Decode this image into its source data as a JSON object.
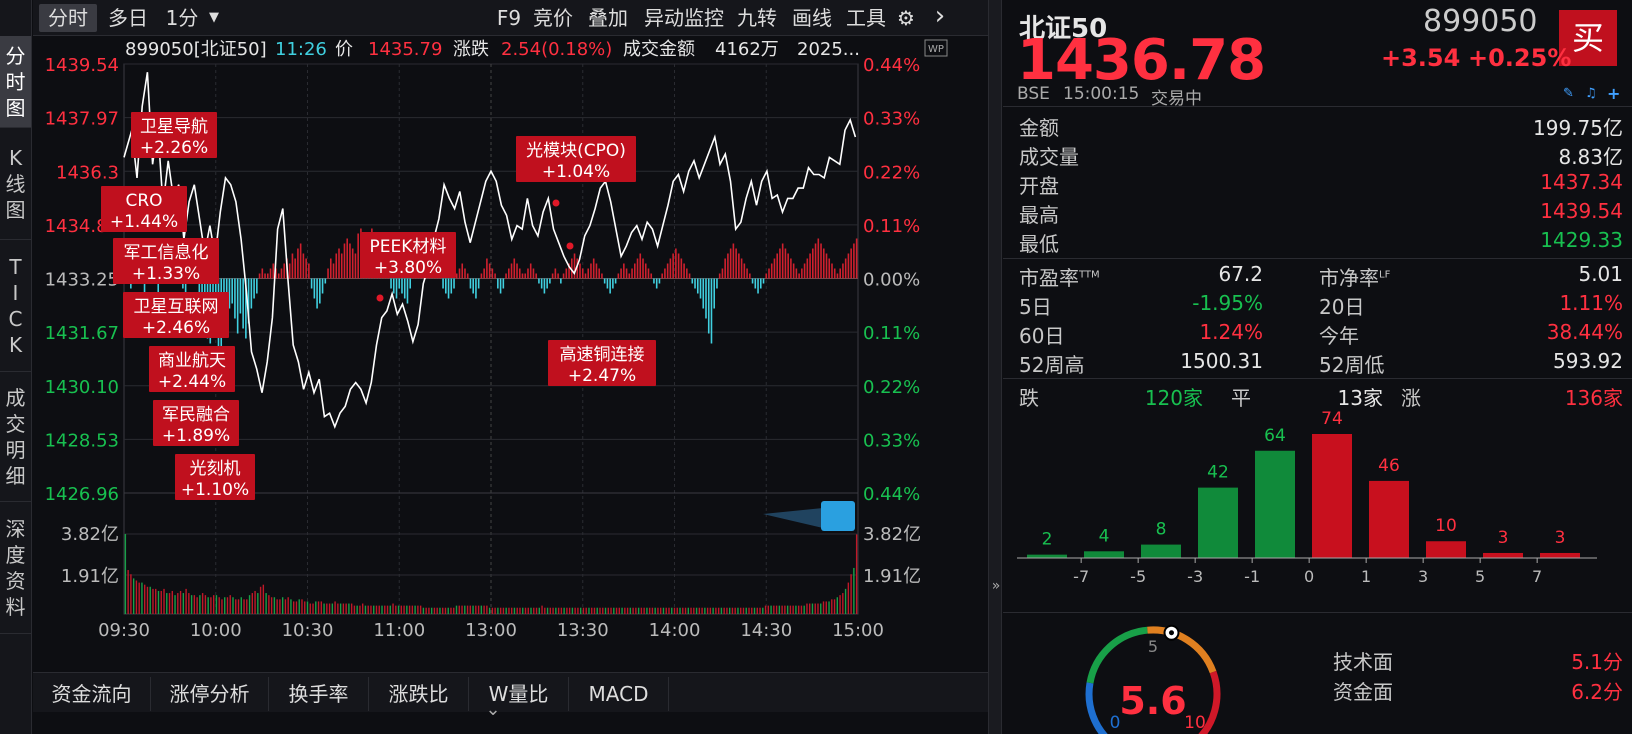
{
  "toolbar": {
    "tabs": [
      "分时",
      "多日",
      "1分"
    ],
    "dropdown_arrow": "▼",
    "items": [
      "F9",
      "竞价",
      "叠加",
      "异动监控",
      "九转",
      "画线",
      "工具"
    ],
    "gear": "⚙",
    "next": "›"
  },
  "sidebar": {
    "items": [
      [
        "分",
        "时",
        "图"
      ],
      [
        "K",
        "线",
        "图"
      ],
      [
        "T",
        "I",
        "C",
        "K"
      ],
      [
        "成",
        "交",
        "明",
        "细"
      ],
      [
        "深",
        "度",
        "资",
        "料"
      ]
    ]
  },
  "info_line": {
    "code": "899050[北证50]",
    "time": "11:26",
    "price_label": "价",
    "price": "1435.79",
    "change_label": "涨跌",
    "change": "2.54(0.18%)",
    "amount_label": "成交金额",
    "amount": "4162万",
    "date": "2025..."
  },
  "wp_icon": "WP",
  "chart_data": {
    "type": "line",
    "prev_close": 1433.25,
    "price_ticks": [
      "1439.54",
      "1437.97",
      "1436.39",
      "1434.82",
      "1433.25",
      "1431.67",
      "1430.10",
      "1428.53",
      "1426.96"
    ],
    "price_ticks_visible": [
      "1439.54",
      "1437.97",
      "1436.3",
      "1434.82",
      "1433.25",
      "1431.67",
      "1430.10",
      "1428.53",
      "1426.96"
    ],
    "pct_ticks": [
      "0.44%",
      "0.33%",
      "0.22%",
      "0.11%",
      "0.00%",
      "0.11%",
      "0.22%",
      "0.33%",
      "0.44%"
    ],
    "pct_colors": [
      "#ff3040",
      "#ff3040",
      "#ff3040",
      "#ff3040",
      "#bbbbbb",
      "#18c050",
      "#18c050",
      "#18c050",
      "#18c050"
    ],
    "ylim": [
      1426.96,
      1439.54
    ],
    "time_ticks": [
      "09:30",
      "10:00",
      "10:30",
      "11:00",
      "13:00",
      "13:30",
      "14:00",
      "14:30",
      "15:00"
    ],
    "volume_ticks": [
      "3.82亿",
      "1.91亿"
    ],
    "price_series": [
      [
        0,
        1436.8
      ],
      [
        3,
        1437.6
      ],
      [
        5,
        1436.2
      ],
      [
        7,
        1438.3
      ],
      [
        9,
        1439.3
      ],
      [
        11,
        1436.6
      ],
      [
        13,
        1437.7
      ],
      [
        15,
        1435.4
      ],
      [
        17,
        1436.7
      ],
      [
        19,
        1435.6
      ],
      [
        21,
        1436.0
      ],
      [
        23,
        1434.4
      ],
      [
        25,
        1435.5
      ],
      [
        27,
        1436.0
      ],
      [
        29,
        1435.0
      ],
      [
        31,
        1434.0
      ],
      [
        33,
        1434.8
      ],
      [
        35,
        1433.9
      ],
      [
        37,
        1435.2
      ],
      [
        39,
        1436.2
      ],
      [
        41,
        1436.0
      ],
      [
        43,
        1435.5
      ],
      [
        45,
        1434.4
      ],
      [
        47,
        1432.9
      ],
      [
        49,
        1431.1
      ],
      [
        51,
        1430.6
      ],
      [
        53,
        1429.9
      ],
      [
        55,
        1430.8
      ],
      [
        57,
        1432.1
      ],
      [
        59,
        1434.7
      ],
      [
        61,
        1435.3
      ],
      [
        63,
        1433.2
      ],
      [
        65,
        1431.3
      ],
      [
        67,
        1430.8
      ],
      [
        69,
        1430.0
      ],
      [
        71,
        1430.5
      ],
      [
        73,
        1429.9
      ],
      [
        75,
        1430.3
      ],
      [
        77,
        1429.2
      ],
      [
        79,
        1429.3
      ],
      [
        81,
        1428.9
      ],
      [
        83,
        1429.3
      ],
      [
        85,
        1429.5
      ],
      [
        87,
        1430.0
      ],
      [
        89,
        1430.2
      ],
      [
        91,
        1430.0
      ],
      [
        93,
        1429.6
      ],
      [
        95,
        1430.2
      ],
      [
        97,
        1431.3
      ],
      [
        99,
        1432.1
      ],
      [
        101,
        1432.3
      ],
      [
        103,
        1432.8
      ],
      [
        105,
        1432.2
      ],
      [
        107,
        1432.5
      ],
      [
        109,
        1432.0
      ],
      [
        111,
        1431.4
      ],
      [
        113,
        1431.9
      ],
      [
        115,
        1433.1
      ],
      [
        117,
        1433.6
      ],
      [
        119,
        1434.4
      ],
      [
        121,
        1435.0
      ],
      [
        123,
        1436.0
      ],
      [
        125,
        1435.6
      ],
      [
        127,
        1435.3
      ],
      [
        129,
        1435.8
      ],
      [
        131,
        1434.9
      ],
      [
        133,
        1434.3
      ],
      [
        135,
        1434.9
      ],
      [
        137,
        1435.5
      ],
      [
        139,
        1436.1
      ],
      [
        141,
        1436.4
      ],
      [
        143,
        1436.1
      ],
      [
        145,
        1435.4
      ],
      [
        147,
        1435.1
      ],
      [
        149,
        1434.4
      ],
      [
        151,
        1434.8
      ],
      [
        153,
        1434.7
      ],
      [
        155,
        1435.6
      ],
      [
        157,
        1434.8
      ],
      [
        159,
        1434.5
      ],
      [
        161,
        1435.2
      ],
      [
        163,
        1435.6
      ],
      [
        165,
        1434.7
      ],
      [
        167,
        1434.3
      ],
      [
        169,
        1433.9
      ],
      [
        171,
        1433.6
      ],
      [
        173,
        1433.4
      ],
      [
        175,
        1433.8
      ],
      [
        177,
        1434.5
      ],
      [
        179,
        1434.8
      ],
      [
        181,
        1435.3
      ],
      [
        183,
        1435.9
      ],
      [
        185,
        1436.1
      ],
      [
        187,
        1435.5
      ],
      [
        189,
        1434.7
      ],
      [
        191,
        1433.9
      ],
      [
        193,
        1434.2
      ],
      [
        195,
        1434.6
      ],
      [
        197,
        1434.8
      ],
      [
        199,
        1434.4
      ],
      [
        201,
        1434.9
      ],
      [
        203,
        1434.7
      ],
      [
        205,
        1434.2
      ],
      [
        207,
        1434.8
      ],
      [
        209,
        1435.4
      ],
      [
        211,
        1436.1
      ],
      [
        213,
        1436.3
      ],
      [
        215,
        1435.8
      ],
      [
        217,
        1436.4
      ],
      [
        219,
        1436.7
      ],
      [
        221,
        1436.2
      ],
      [
        223,
        1436.6
      ],
      [
        225,
        1437.0
      ],
      [
        227,
        1437.4
      ],
      [
        229,
        1436.6
      ],
      [
        231,
        1436.9
      ],
      [
        233,
        1436.1
      ],
      [
        235,
        1434.7
      ],
      [
        237,
        1434.9
      ],
      [
        239,
        1435.6
      ],
      [
        241,
        1436.1
      ],
      [
        243,
        1435.4
      ],
      [
        245,
        1436.1
      ],
      [
        247,
        1436.4
      ],
      [
        249,
        1435.6
      ],
      [
        251,
        1435.7
      ],
      [
        253,
        1435.2
      ],
      [
        255,
        1435.6
      ],
      [
        257,
        1435.6
      ],
      [
        259,
        1435.9
      ],
      [
        261,
        1435.9
      ],
      [
        263,
        1436.5
      ],
      [
        265,
        1436.3
      ],
      [
        267,
        1436.3
      ],
      [
        269,
        1436.2
      ],
      [
        271,
        1436.8
      ],
      [
        273,
        1436.7
      ],
      [
        275,
        1436.6
      ],
      [
        277,
        1437.6
      ],
      [
        279,
        1437.9
      ],
      [
        281,
        1437.4
      ]
    ],
    "volume_bars": [
      3.82,
      2.1,
      1.9,
      1.7,
      1.6,
      1.5,
      1.5,
      1.4,
      1.3,
      1.3,
      1.2,
      1.2,
      1.1,
      1.1,
      1.2,
      1.0,
      1.0,
      1.1,
      0.9,
      1.0,
      1.1,
      1.0,
      1.2,
      1.0,
      0.9,
      0.9,
      0.8,
      0.9,
      1.0,
      0.9,
      0.8,
      0.8,
      0.9,
      0.9,
      0.8,
      0.7,
      0.8,
      0.8,
      0.9,
      0.8,
      0.7,
      0.7,
      0.8,
      0.7,
      0.7,
      0.9,
      1.0,
      1.1,
      1.0,
      1.3,
      1.4,
      1.0,
      0.9,
      0.8,
      0.8,
      0.7,
      0.7,
      0.8,
      0.7,
      0.8,
      0.7,
      0.6,
      0.6,
      0.7,
      0.7,
      0.6,
      0.6,
      0.5,
      0.5,
      0.6,
      0.6,
      0.6,
      0.5,
      0.5,
      0.5,
      0.5,
      0.6,
      0.5,
      0.5,
      0.5,
      0.5,
      0.5,
      0.5,
      0.4,
      0.4,
      0.4,
      0.5,
      0.4,
      0.4,
      0.4,
      0.4,
      0.4,
      0.4,
      0.4,
      0.4,
      0.4,
      0.4,
      0.5,
      0.4,
      0.4,
      0.4,
      0.4,
      0.4,
      0.4,
      0.4,
      0.4,
      0.4,
      0.4,
      0.3,
      0.3,
      0.3,
      0.3,
      0.3,
      0.3,
      0.3,
      0.3,
      0.3,
      0.3,
      0.3,
      0.3,
      0.4,
      0.4,
      0.4,
      0.4,
      0.4,
      0.4,
      0.4,
      0.4,
      0.4,
      0.4,
      0.4,
      0.4,
      0.3,
      0.3,
      0.3,
      0.3,
      0.3,
      0.3,
      0.3,
      0.3,
      0.3,
      0.3,
      0.3,
      0.3,
      0.3,
      0.3,
      0.3,
      0.3,
      0.3,
      0.3,
      0.3,
      0.4,
      0.3,
      0.3,
      0.3,
      0.3,
      0.3,
      0.3,
      0.3,
      0.3,
      0.3,
      0.3,
      0.3,
      0.3,
      0.3,
      0.3,
      0.3,
      0.3,
      0.3,
      0.3,
      0.3,
      0.3,
      0.3,
      0.3,
      0.3,
      0.3,
      0.3,
      0.3,
      0.3,
      0.3,
      0.3,
      0.3,
      0.3,
      0.3,
      0.3,
      0.3,
      0.3,
      0.3,
      0.3,
      0.3,
      0.3,
      0.3,
      0.3,
      0.3,
      0.3,
      0.3,
      0.3,
      0.3,
      0.3,
      0.3,
      0.3,
      0.3,
      0.3,
      0.3,
      0.3,
      0.3,
      0.3,
      0.3,
      0.3,
      0.3,
      0.3,
      0.3,
      0.3,
      0.3,
      0.3,
      0.3,
      0.3,
      0.3,
      0.3,
      0.3,
      0.3,
      0.3,
      0.3,
      0.3,
      0.3,
      0.3,
      0.3,
      0.3,
      0.3,
      0.3,
      0.3,
      0.3,
      0.4,
      0.4,
      0.4,
      0.4,
      0.4,
      0.4,
      0.4,
      0.4,
      0.4,
      0.4,
      0.4,
      0.4,
      0.4,
      0.4,
      0.4,
      0.5,
      0.5,
      0.5,
      0.5,
      0.5,
      0.5,
      0.6,
      0.6,
      0.6,
      0.7,
      0.7,
      0.8,
      0.9,
      1.0,
      1.2,
      1.5,
      1.9,
      2.2,
      3.8
    ],
    "breadth_bars": [
      2.5,
      3.5,
      -1.0,
      1.5,
      3.0,
      2.0,
      0.5,
      -1.5,
      2.0,
      1.5,
      3.0,
      2.5,
      -2.0,
      1.0,
      2.0,
      1.5,
      3.5,
      2.0,
      1.0,
      2.5,
      1.5,
      -1.0,
      -2.0,
      1.5,
      2.5,
      2.0,
      1.0,
      -3.0,
      -4.5,
      -5.0,
      -6.0,
      -6.5,
      -4.0,
      -5.5,
      -7.0,
      -7.5,
      -5.0,
      -4.0,
      -3.0,
      -2.5,
      -4.0,
      -5.5,
      -3.5,
      -5.0,
      -6.0,
      -4.5,
      -3.0,
      -2.0,
      -1.5,
      0.5,
      1.0,
      0.5,
      0.5,
      1.0,
      1.5,
      1.0,
      0.5,
      1.0,
      1.5,
      2.0,
      1.5,
      2.5,
      2.0,
      3.0,
      3.5,
      2.5,
      2.0,
      1.5,
      -1.0,
      -2.0,
      -3.0,
      -2.5,
      -1.5,
      -0.5,
      1.0,
      2.0,
      1.5,
      2.5,
      3.0,
      2.5,
      3.5,
      4.0,
      3.5,
      3.0,
      2.5,
      4.5,
      5.0,
      4.0,
      3.5,
      4.5,
      5.0,
      4.0,
      3.0,
      2.0,
      1.5,
      1.0,
      0.5,
      -1.0,
      -1.5,
      -2.0,
      -1.0,
      -1.5,
      -2.0,
      -2.5,
      -1.0,
      0.5,
      1.0,
      1.5,
      2.0,
      1.5,
      1.0,
      1.5,
      2.0,
      1.5,
      1.0,
      0.5,
      -1.0,
      -1.5,
      -2.0,
      -1.5,
      -1.0,
      0.5,
      1.0,
      1.5,
      1.0,
      0.5,
      -1.0,
      -1.5,
      -2.0,
      -1.0,
      0.5,
      1.0,
      2.0,
      1.5,
      1.0,
      0.5,
      -1.0,
      -1.5,
      -1.0,
      0.5,
      1.0,
      1.5,
      2.0,
      1.5,
      1.0,
      0.5,
      0.5,
      1.0,
      1.5,
      1.0,
      0.5,
      -0.5,
      -1.0,
      -1.5,
      -1.0,
      -0.5,
      0.5,
      1.0,
      0.5,
      -0.5,
      0.5,
      1.0,
      1.5,
      2.0,
      2.5,
      2.0,
      1.5,
      1.0,
      0.5,
      1.0,
      1.5,
      2.0,
      1.5,
      1.0,
      0.5,
      -0.5,
      -1.0,
      -1.5,
      -1.0,
      -0.5,
      0.5,
      1.0,
      1.5,
      1.0,
      0.5,
      1.0,
      1.5,
      2.0,
      2.5,
      2.0,
      1.5,
      1.0,
      0.5,
      -0.5,
      -1.0,
      -0.5,
      0.5,
      1.0,
      1.5,
      2.0,
      2.5,
      3.0,
      2.5,
      2.0,
      1.5,
      1.0,
      0.5,
      -0.5,
      -1.0,
      -1.5,
      -2.0,
      -3.0,
      -4.0,
      -5.5,
      -6.5,
      -3.0,
      -1.0,
      0.5,
      1.0,
      2.0,
      2.5,
      3.0,
      3.5,
      3.0,
      2.5,
      2.0,
      1.5,
      1.0,
      0.5,
      -0.5,
      -1.0,
      -1.5,
      -1.0,
      -0.5,
      0.5,
      1.0,
      1.5,
      2.0,
      2.5,
      3.0,
      3.5,
      3.0,
      2.5,
      2.0,
      1.5,
      1.0,
      0.5,
      1.0,
      1.5,
      2.0,
      2.5,
      3.0,
      3.5,
      4.0,
      3.5,
      3.0,
      2.5,
      2.0,
      1.5,
      1.0,
      0.5,
      1.0,
      1.5,
      2.0,
      2.5,
      3.0,
      3.5,
      4.0
    ],
    "tags": [
      {
        "name": "卫星导航",
        "pct": "+2.26%"
      },
      {
        "name": "CRO",
        "pct": "+1.44%"
      },
      {
        "name": "军工信息化",
        "pct": "+1.33%"
      },
      {
        "name": "卫星互联网",
        "pct": "+2.46%"
      },
      {
        "name": "商业航天",
        "pct": "+2.44%"
      },
      {
        "name": "军民融合",
        "pct": "+1.89%"
      },
      {
        "name": "光刻机",
        "pct": "+1.10%"
      },
      {
        "name": "PEEK材料",
        "pct": "+3.80%"
      },
      {
        "name": "光模块(CPO)",
        "pct": "+1.04%"
      },
      {
        "name": "高速铜连接",
        "pct": "+2.47%"
      }
    ]
  },
  "bottom_tabs": [
    "资金流向",
    "涨停分析",
    "换手率",
    "涨跌比",
    "W量比",
    "MACD"
  ],
  "bottom_arrow": "⌄",
  "expander_arrow": "»",
  "quote": {
    "name": "北证50",
    "code": "899050",
    "price": "1436.78",
    "change": "+3.54",
    "change_pct": "+0.25%",
    "exchange": "BSE",
    "time": "15:00:15",
    "status": "交易中",
    "buy_label": "买"
  },
  "stats": [
    {
      "label": "金额",
      "value": "199.75亿",
      "color": "white"
    },
    {
      "label": "成交量",
      "value": "8.83亿",
      "color": "white"
    },
    {
      "label": "开盘",
      "value": "1437.34",
      "color": "red"
    },
    {
      "label": "最高",
      "value": "1439.54",
      "color": "red"
    },
    {
      "label": "最低",
      "value": "1429.33",
      "color": "green"
    }
  ],
  "stats2": [
    {
      "label": "市盈率",
      "sup": "TTM",
      "value": "67.2",
      "color": "white",
      "label2": "市净率",
      "sup2": "LF",
      "value2": "5.01",
      "color2": "white"
    },
    {
      "label": "5日",
      "sup": "",
      "value": "-1.95%",
      "color": "green",
      "label2": "20日",
      "sup2": "",
      "value2": "1.11%",
      "color2": "red"
    },
    {
      "label": "60日",
      "sup": "",
      "value": "1.24%",
      "color": "red",
      "label2": "今年",
      "sup2": "",
      "value2": "38.44%",
      "color2": "red"
    },
    {
      "label": "52周高",
      "sup": "",
      "value": "1500.31",
      "color": "white",
      "label2": "52周低",
      "sup2": "",
      "value2": "593.92",
      "color2": "white"
    }
  ],
  "breadth": {
    "down_label": "跌",
    "down_value": "120家",
    "flat_label": "平",
    "flat_value": "13家",
    "up_label": "涨",
    "up_value": "136家"
  },
  "dist_chart": {
    "type": "bar",
    "values": [
      2,
      4,
      8,
      42,
      64,
      74,
      46,
      10,
      3,
      3
    ],
    "colors": [
      "green",
      "green",
      "green",
      "green",
      "green",
      "red",
      "red",
      "red",
      "red",
      "red"
    ],
    "xticks": [
      "-7",
      "-5",
      "-3",
      "-1",
      "0",
      "1",
      "3",
      "5",
      "7"
    ]
  },
  "gauge": {
    "value": 5.6,
    "value_text": "5.6",
    "min_label": "0",
    "mid_label": "5",
    "max_label": "10",
    "tech_label": "技术面",
    "tech_value": "5.1分",
    "fund_label": "资金面",
    "fund_value": "6.2分"
  },
  "colors": {
    "red": "#ff3040",
    "green": "#18c050",
    "line": "#ffffff",
    "tag_bg": "#c0101e",
    "cyan": "#40d0e0"
  }
}
